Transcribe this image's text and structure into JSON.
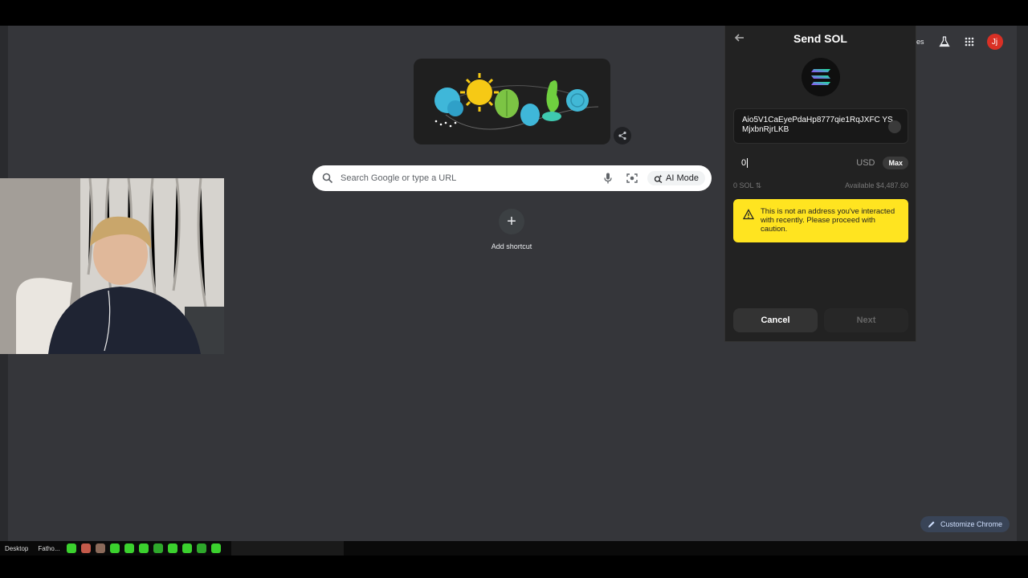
{
  "new_tab": {
    "search_placeholder": "Search Google or type a URL",
    "ai_mode_label": "AI Mode",
    "add_shortcut_label": "Add shortcut",
    "customize_label": "Customize Chrome",
    "top_right_text": "ges",
    "avatar_initial": "Jj"
  },
  "wallet": {
    "title": "Send SOL",
    "address_value": "Aio5V1CaEyePdaHp8777qie1RqJXFC YSMjxbnRjrLKB",
    "amount_value": "0",
    "amount_currency": "USD",
    "max_label": "Max",
    "sol_amount": "0 SOL ⇅",
    "available": "Available $4,487.60",
    "warning_text": "This is not an address you've interacted with recently. Please proceed with caution.",
    "cancel_label": "Cancel",
    "next_label": "Next"
  },
  "taskbar": {
    "items": [
      "Desktop",
      "Fatho..."
    ]
  },
  "colors": {
    "page_bg": "#35363a",
    "wallet_bg": "#222222",
    "warning_bg": "#ffe420",
    "avatar_bg": "#d93025",
    "sol_purple": "#9945ff",
    "sol_green": "#14f195"
  }
}
